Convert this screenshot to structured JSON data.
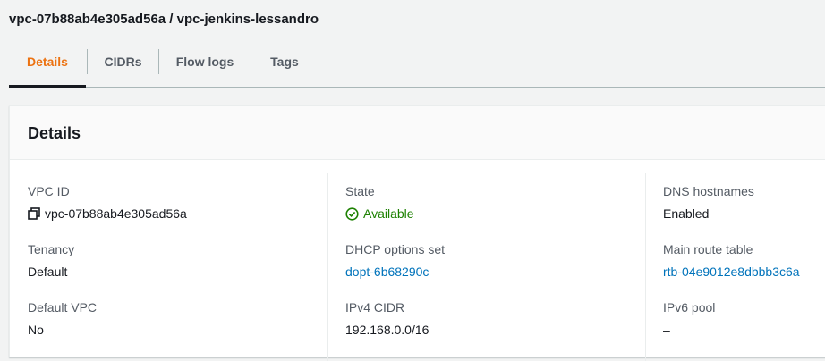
{
  "page": {
    "title": "vpc-07b88ab4e305ad56a / vpc-jenkins-lessandro"
  },
  "tabs": [
    {
      "label": "Details",
      "active": true
    },
    {
      "label": "CIDRs",
      "active": false
    },
    {
      "label": "Flow logs",
      "active": false
    },
    {
      "label": "Tags",
      "active": false
    }
  ],
  "panel": {
    "title": "Details"
  },
  "details": {
    "vpc_id": {
      "label": "VPC ID",
      "value": "vpc-07b88ab4e305ad56a",
      "icon": "copy-icon"
    },
    "tenancy": {
      "label": "Tenancy",
      "value": "Default"
    },
    "default_vpc": {
      "label": "Default VPC",
      "value": "No"
    },
    "state": {
      "label": "State",
      "value": "Available",
      "icon": "check-circle-icon"
    },
    "dhcp": {
      "label": "DHCP options set",
      "value": "dopt-6b68290c"
    },
    "ipv4": {
      "label": "IPv4 CIDR",
      "value": "192.168.0.0/16"
    },
    "dns": {
      "label": "DNS hostnames",
      "value": "Enabled"
    },
    "route": {
      "label": "Main route table",
      "value": "rtb-04e9012e8dbbb3c6a"
    },
    "ipv6": {
      "label": "IPv6 pool",
      "value": "–"
    }
  },
  "colors": {
    "accent": "#ec7211",
    "link": "#0073bb",
    "success": "#1d8102",
    "text": "#16191f",
    "muted": "#545b64"
  }
}
